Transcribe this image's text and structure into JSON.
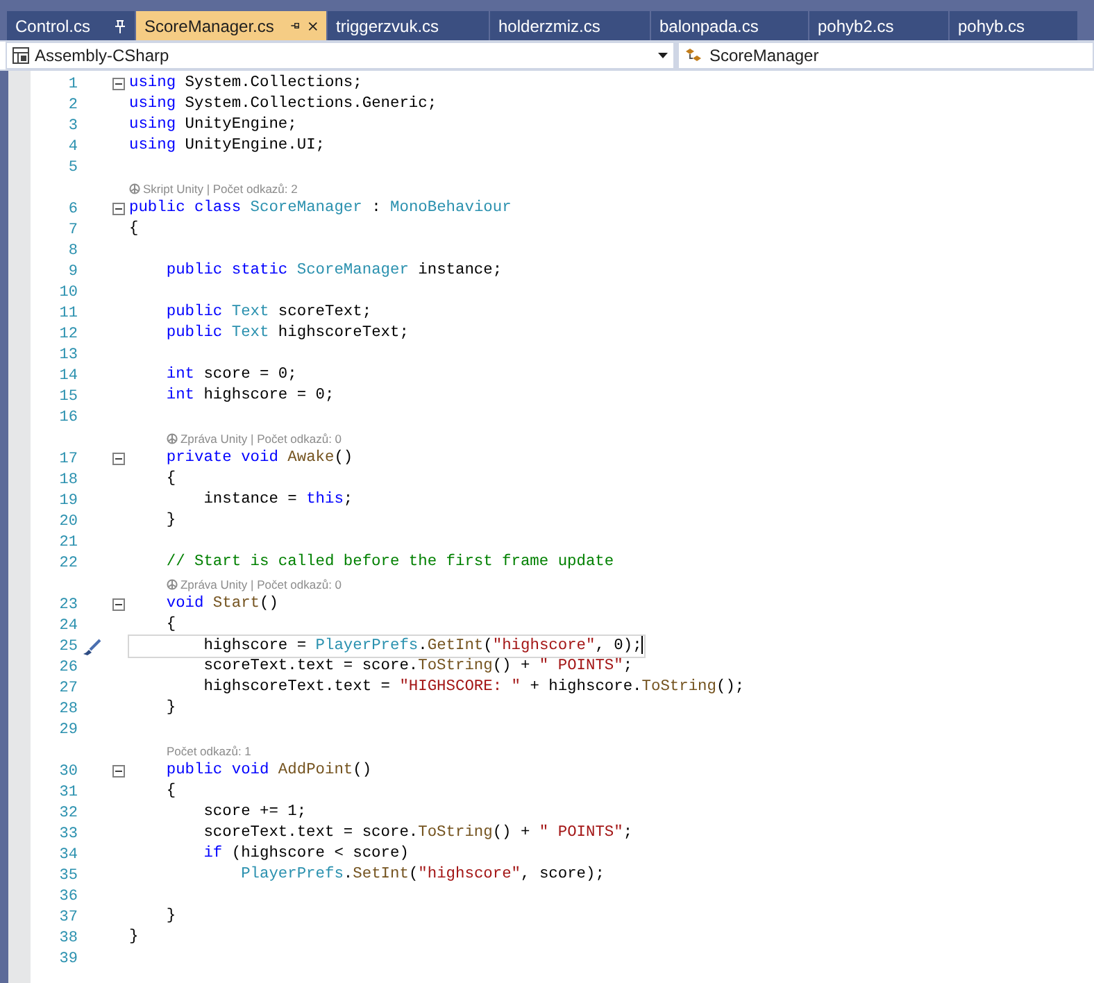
{
  "tabs": [
    {
      "label": "Control.cs",
      "selected": false,
      "pinned": true
    },
    {
      "label": "ScoreManager.cs",
      "selected": true,
      "pinned": false
    },
    {
      "label": "triggerzvuk.cs",
      "selected": false,
      "pinned": false
    },
    {
      "label": "holderzmiz.cs",
      "selected": false,
      "pinned": false
    },
    {
      "label": "balonpada.cs",
      "selected": false,
      "pinned": false
    },
    {
      "label": "pohyb2.cs",
      "selected": false,
      "pinned": false
    },
    {
      "label": "pohyb.cs",
      "selected": false,
      "pinned": false
    }
  ],
  "navigation_bar": {
    "project": "Assembly-CSharp",
    "member": "ScoreManager"
  },
  "editor": {
    "lines": [
      {
        "kind": "code",
        "number": "1",
        "expanded": true,
        "segments": [
          {
            "kind": "kw",
            "text": "using"
          },
          {
            "kind": "plain",
            "text": " System.Collections;"
          }
        ]
      },
      {
        "kind": "code",
        "number": "2",
        "segments": [
          {
            "kind": "kw",
            "text": "using"
          },
          {
            "kind": "plain",
            "text": " System.Collections.Generic;"
          }
        ]
      },
      {
        "kind": "code",
        "number": "3",
        "segments": [
          {
            "kind": "kw",
            "text": "using"
          },
          {
            "kind": "plain",
            "text": " UnityEngine;"
          }
        ]
      },
      {
        "kind": "code",
        "number": "4",
        "segments": [
          {
            "kind": "kw",
            "text": "using"
          },
          {
            "kind": "plain",
            "text": " UnityEngine.UI;"
          }
        ]
      },
      {
        "kind": "code",
        "number": "5"
      },
      {
        "kind": "lens",
        "text": "Skript Unity | Počet odkazů: 2",
        "unity": true
      },
      {
        "kind": "code",
        "number": "6",
        "expanded": true,
        "segments": [
          {
            "kind": "kw",
            "text": "public class"
          },
          {
            "kind": "type",
            "text": " ScoreManager"
          },
          {
            "kind": "plain",
            "text": " : "
          },
          {
            "kind": "type",
            "text": "MonoBehaviour"
          }
        ]
      },
      {
        "kind": "code",
        "number": "7",
        "segments": [
          {
            "kind": "plain",
            "text": "{"
          }
        ]
      },
      {
        "kind": "code",
        "number": "8"
      },
      {
        "kind": "code",
        "number": "9",
        "segments": [
          {
            "kind": "kw",
            "text": "    public static"
          },
          {
            "kind": "type",
            "text": " ScoreManager"
          },
          {
            "kind": "plain",
            "text": " instance;"
          }
        ]
      },
      {
        "kind": "code",
        "number": "10"
      },
      {
        "kind": "code",
        "number": "11",
        "segments": [
          {
            "kind": "kw",
            "text": "    public"
          },
          {
            "kind": "type",
            "text": " Text"
          },
          {
            "kind": "plain",
            "text": " scoreText;"
          }
        ]
      },
      {
        "kind": "code",
        "number": "12",
        "segments": [
          {
            "kind": "kw",
            "text": "    public"
          },
          {
            "kind": "type",
            "text": " Text"
          },
          {
            "kind": "plain",
            "text": " highscoreText;"
          }
        ]
      },
      {
        "kind": "code",
        "number": "13"
      },
      {
        "kind": "code",
        "number": "14",
        "segments": [
          {
            "kind": "kw",
            "text": "    int"
          },
          {
            "kind": "plain",
            "text": " score = 0;"
          }
        ]
      },
      {
        "kind": "code",
        "number": "15",
        "segments": [
          {
            "kind": "kw",
            "text": "    int"
          },
          {
            "kind": "plain",
            "text": " highscore = 0;"
          }
        ]
      },
      {
        "kind": "code",
        "number": "16"
      },
      {
        "kind": "lens",
        "text": "Zpráva Unity | Počet odkazů: 0",
        "unity": true
      },
      {
        "kind": "code",
        "number": "17",
        "expanded": true,
        "segments": [
          {
            "kind": "kw",
            "text": "    private void"
          },
          {
            "kind": "method",
            "text": " Awake"
          },
          {
            "kind": "plain",
            "text": "()"
          }
        ]
      },
      {
        "kind": "code",
        "number": "18",
        "segments": [
          {
            "kind": "plain",
            "text": "    {"
          }
        ]
      },
      {
        "kind": "code",
        "number": "19",
        "segments": [
          {
            "kind": "plain",
            "text": "        instance = "
          },
          {
            "kind": "kw",
            "text": "this"
          },
          {
            "kind": "plain",
            "text": ";"
          }
        ]
      },
      {
        "kind": "code",
        "number": "20",
        "segments": [
          {
            "kind": "plain",
            "text": "    }"
          }
        ]
      },
      {
        "kind": "code",
        "number": "21"
      },
      {
        "kind": "code",
        "number": "22",
        "segments": [
          {
            "kind": "cm",
            "text": "    // Start is called before the first frame update"
          }
        ]
      },
      {
        "kind": "lens",
        "text": "Zpráva Unity | Počet odkazů: 0",
        "unity": true
      },
      {
        "kind": "code",
        "number": "23",
        "expanded": true,
        "segments": [
          {
            "kind": "kw",
            "text": "    void"
          },
          {
            "kind": "method",
            "text": " Start"
          },
          {
            "kind": "plain",
            "text": "()"
          }
        ]
      },
      {
        "kind": "code",
        "number": "24",
        "segments": [
          {
            "kind": "plain",
            "text": "    {"
          }
        ]
      },
      {
        "kind": "code",
        "number": "25",
        "current": true,
        "segments": [
          {
            "kind": "plain",
            "text": "        highscore = "
          },
          {
            "kind": "type",
            "text": "PlayerPrefs"
          },
          {
            "kind": "plain",
            "text": "."
          },
          {
            "kind": "method",
            "text": "GetInt"
          },
          {
            "kind": "plain",
            "text": "("
          },
          {
            "kind": "str",
            "text": "\"highscore\""
          },
          {
            "kind": "plain",
            "text": ", 0);"
          }
        ]
      },
      {
        "kind": "code",
        "number": "26",
        "segments": [
          {
            "kind": "plain",
            "text": "        scoreText.text = score."
          },
          {
            "kind": "method",
            "text": "ToString"
          },
          {
            "kind": "plain",
            "text": "() + "
          },
          {
            "kind": "str",
            "text": "\" POINTS\""
          },
          {
            "kind": "plain",
            "text": ";"
          }
        ]
      },
      {
        "kind": "code",
        "number": "27",
        "segments": [
          {
            "kind": "plain",
            "text": "        highscoreText.text = "
          },
          {
            "kind": "str",
            "text": "\"HIGHSCORE: \""
          },
          {
            "kind": "plain",
            "text": " + highscore."
          },
          {
            "kind": "method",
            "text": "ToString"
          },
          {
            "kind": "plain",
            "text": "();"
          }
        ]
      },
      {
        "kind": "code",
        "number": "28",
        "segments": [
          {
            "kind": "plain",
            "text": "    }"
          }
        ]
      },
      {
        "kind": "code",
        "number": "29"
      },
      {
        "kind": "lens",
        "text": "Počet odkazů: 1",
        "unity": false
      },
      {
        "kind": "code",
        "number": "30",
        "expanded": true,
        "segments": [
          {
            "kind": "kw",
            "text": "    public void"
          },
          {
            "kind": "method",
            "text": " AddPoint"
          },
          {
            "kind": "plain",
            "text": "()"
          }
        ]
      },
      {
        "kind": "code",
        "number": "31",
        "segments": [
          {
            "kind": "plain",
            "text": "    {"
          }
        ]
      },
      {
        "kind": "code",
        "number": "32",
        "segments": [
          {
            "kind": "plain",
            "text": "        score += 1;"
          }
        ]
      },
      {
        "kind": "code",
        "number": "33",
        "segments": [
          {
            "kind": "plain",
            "text": "        scoreText.text = score."
          },
          {
            "kind": "method",
            "text": "ToString"
          },
          {
            "kind": "plain",
            "text": "() + "
          },
          {
            "kind": "str",
            "text": "\" POINTS\""
          },
          {
            "kind": "plain",
            "text": ";"
          }
        ]
      },
      {
        "kind": "code",
        "number": "34",
        "segments": [
          {
            "kind": "kw",
            "text": "        if"
          },
          {
            "kind": "plain",
            "text": " (highscore < score)"
          }
        ]
      },
      {
        "kind": "code",
        "number": "35",
        "segments": [
          {
            "kind": "type",
            "text": "            PlayerPrefs"
          },
          {
            "kind": "plain",
            "text": "."
          },
          {
            "kind": "method",
            "text": "SetInt"
          },
          {
            "kind": "plain",
            "text": "("
          },
          {
            "kind": "str",
            "text": "\"highscore\""
          },
          {
            "kind": "plain",
            "text": ", score);"
          }
        ]
      },
      {
        "kind": "code",
        "number": "36"
      },
      {
        "kind": "code",
        "number": "37",
        "segments": [
          {
            "kind": "plain",
            "text": "    }"
          }
        ]
      },
      {
        "kind": "code",
        "number": "38",
        "segments": [
          {
            "kind": "plain",
            "text": "}"
          }
        ]
      },
      {
        "kind": "code",
        "number": "39"
      }
    ]
  }
}
